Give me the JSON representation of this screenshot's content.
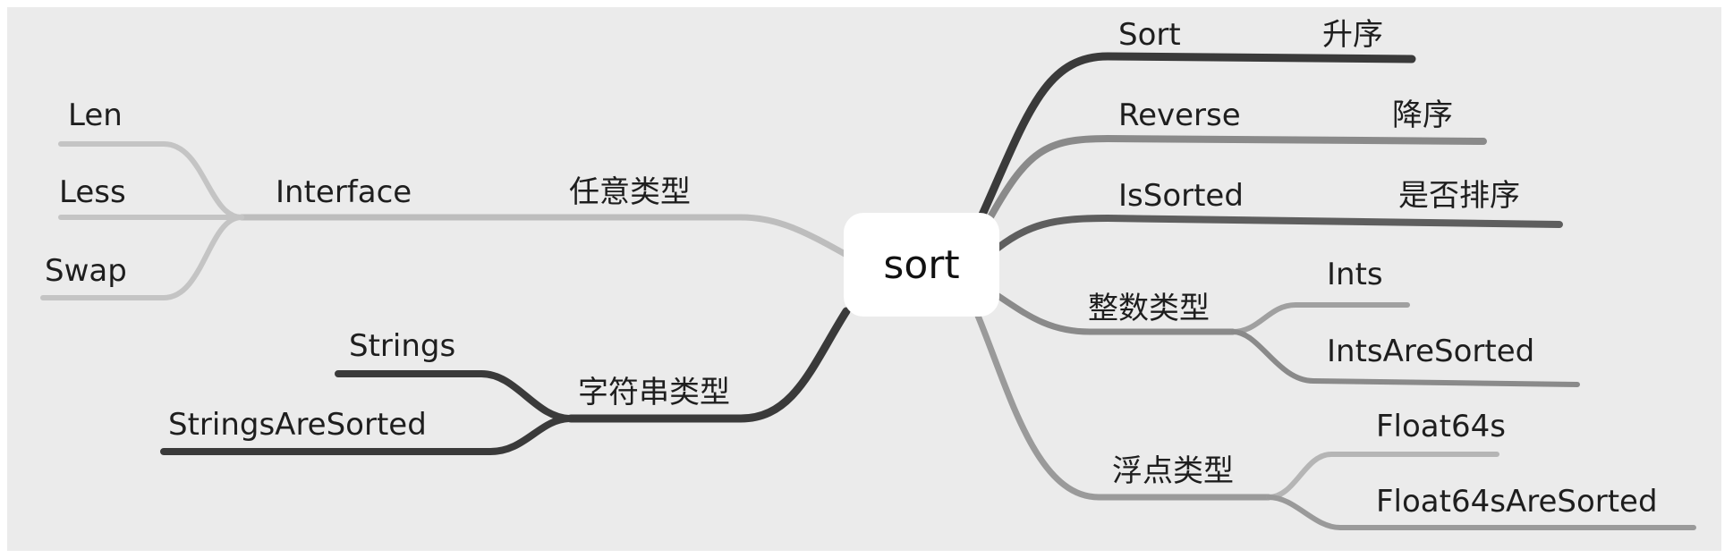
{
  "root": {
    "label": "sort"
  },
  "branches": {
    "sort": {
      "label": "Sort",
      "desc": "升序"
    },
    "reverse": {
      "label": "Reverse",
      "desc": "降序"
    },
    "is_sorted": {
      "label": "IsSorted",
      "desc": "是否排序"
    },
    "int_type": {
      "label": "整数类型"
    },
    "ints": {
      "label": "Ints"
    },
    "ints_are_sorted": {
      "label": "IntsAreSorted"
    },
    "float_type": {
      "label": "浮点类型"
    },
    "float64s": {
      "label": "Float64s"
    },
    "float64s_are_sorted": {
      "label": "Float64sAreSorted"
    },
    "any_type": {
      "label": "任意类型"
    },
    "interface": {
      "label": "Interface"
    },
    "len": {
      "label": "Len"
    },
    "less": {
      "label": "Less"
    },
    "swap": {
      "label": "Swap"
    },
    "string_type": {
      "label": "字符串类型"
    },
    "strings": {
      "label": "Strings"
    },
    "strings_are_sorted": {
      "label": "StringsAreSorted"
    }
  },
  "colors": {
    "background": "#ebebeb",
    "node_fill": "#ffffff",
    "dark_branch": "#3a3a3a",
    "mid_branch": "#8a8a8a",
    "light_branch": "#bdbdbd",
    "text": "#1e1e1e"
  }
}
